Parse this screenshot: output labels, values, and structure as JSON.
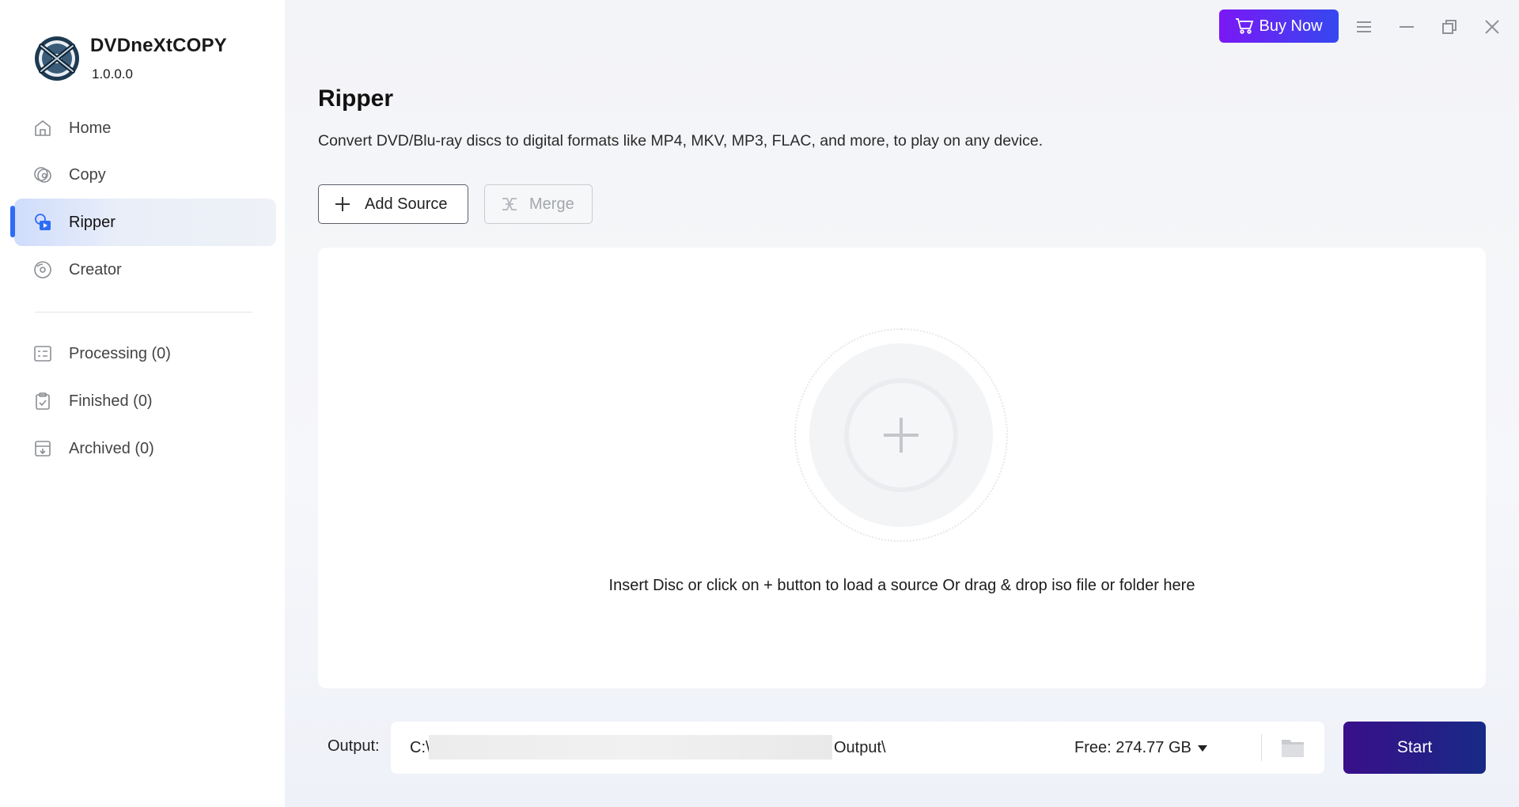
{
  "app": {
    "name": "DVDneXtCOPY",
    "version": "1.0.0.0"
  },
  "sidebar": {
    "items": [
      {
        "label": "Home",
        "icon": "home-icon"
      },
      {
        "label": "Copy",
        "icon": "disc-copy-icon"
      },
      {
        "label": "Ripper",
        "icon": "ripper-icon",
        "active": true
      },
      {
        "label": "Creator",
        "icon": "disc-create-icon"
      }
    ],
    "queues": [
      {
        "label": "Processing (0)",
        "icon": "processing-list-icon"
      },
      {
        "label": "Finished (0)",
        "icon": "clipboard-check-icon"
      },
      {
        "label": "Archived (0)",
        "icon": "archive-box-icon"
      }
    ]
  },
  "titlebar": {
    "buy_label": "Buy Now"
  },
  "main": {
    "title": "Ripper",
    "description": "Convert DVD/Blu-ray discs to digital formats like MP4, MKV, MP3, FLAC, and more, to play on any device.",
    "add_source_label": "Add Source",
    "merge_label": "Merge",
    "drop_hint": "Insert Disc or click on + button to load a source Or drag & drop iso file or folder here"
  },
  "output": {
    "label": "Output:",
    "path_start": "C:\\",
    "path_end": "Output\\",
    "free_space": "Free: 274.77 GB"
  },
  "start_label": "Start",
  "colors": {
    "accent_blue": "#2f6cf6",
    "buy_gradient_start": "#7b17f5",
    "buy_gradient_end": "#3548f0",
    "start_gradient_start": "#3a0f8a",
    "start_gradient_end": "#172a86"
  }
}
